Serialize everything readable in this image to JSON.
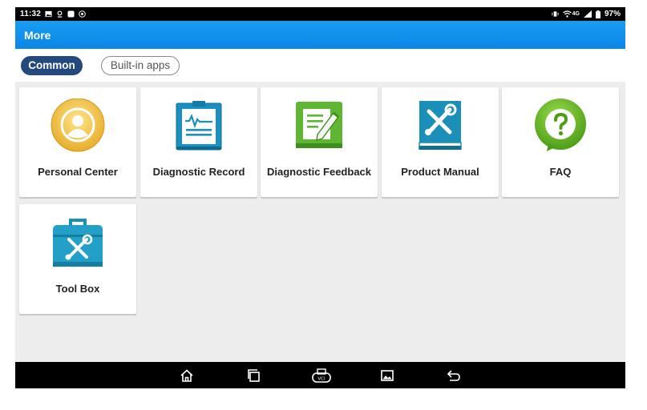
{
  "status_bar": {
    "time": "11:32",
    "battery": "97%",
    "network": "4G",
    "left_icons": [
      "image-icon",
      "location-icon",
      "app-square-icon",
      "settings-badge-icon"
    ],
    "right_icons": [
      "vibrate-icon",
      "wifi-icon",
      "signal-icon",
      "battery-icon"
    ]
  },
  "title_bar": {
    "title": "More"
  },
  "tabs": [
    {
      "label": "Common",
      "active": true
    },
    {
      "label": "Built-in apps",
      "active": false
    }
  ],
  "items": [
    {
      "label": "Personal Center",
      "icon": "personal-center-icon"
    },
    {
      "label": "Diagnostic Record",
      "icon": "diagnostic-record-icon"
    },
    {
      "label": "Diagnostic Feedback",
      "icon": "diagnostic-feedback-icon"
    },
    {
      "label": "Product Manual",
      "icon": "product-manual-icon"
    },
    {
      "label": "FAQ",
      "icon": "faq-icon"
    },
    {
      "label": "Tool Box",
      "icon": "tool-box-icon"
    }
  ],
  "nav_bar": {
    "buttons": [
      "home-icon",
      "recent-apps-icon",
      "vci-icon",
      "screenshot-icon",
      "back-icon"
    ],
    "vci_label": "VCI"
  },
  "colors": {
    "title_bar": "#1592ec",
    "tab_active": "#244a7d",
    "background": "#ededed"
  }
}
